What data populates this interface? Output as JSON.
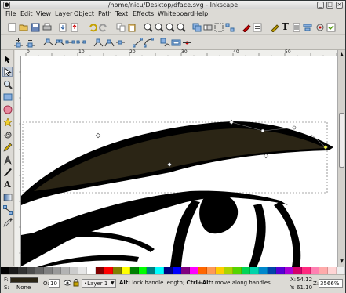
{
  "window": {
    "title": "/home/nicu/Desktop/dface.svg - Inkscape"
  },
  "menu": [
    "File",
    "Edit",
    "View",
    "Layer",
    "Object",
    "Path",
    "Text",
    "Effects",
    "Whiteboard",
    "Help"
  ],
  "commands_bar": {
    "text_tool_glyph": "T"
  },
  "tools": [
    {
      "name": "selector-tool-icon"
    },
    {
      "name": "node-tool-icon"
    },
    {
      "name": "zoom-tool-icon"
    },
    {
      "name": "rect-tool-icon"
    },
    {
      "name": "ellipse-tool-icon"
    },
    {
      "name": "star-tool-icon"
    },
    {
      "name": "spiral-tool-icon"
    },
    {
      "name": "pencil-tool-icon"
    },
    {
      "name": "pen-tool-icon"
    },
    {
      "name": "calligraphy-tool-icon"
    },
    {
      "name": "text-tool-icon",
      "glyph": "A"
    },
    {
      "name": "gradient-tool-icon"
    },
    {
      "name": "connector-tool-icon"
    },
    {
      "name": "dropper-tool-icon"
    }
  ],
  "ruler": {
    "labels": [
      "0",
      "10",
      "20",
      "30",
      "40",
      "50"
    ]
  },
  "status": {
    "fill_label": "F:",
    "stroke_label": "S:",
    "stroke_value": "None",
    "opacity_label": "O:",
    "opacity_value": "10",
    "layer_value": "•Layer 1",
    "message_bold": "Alt:",
    "message_rest": " lock handle length; ",
    "message_bold2": "Ctrl+Alt:",
    "message_rest2": " move along handles",
    "x_label": "X:",
    "x_value": "54.12",
    "y_label": "Y:",
    "y_value": "61.10",
    "zoom_label": "Z:",
    "zoom_value": "3566%"
  },
  "colors": {
    "eyebrow_fill": "#2b2515",
    "palette": [
      "#000000",
      "#1a1a1a",
      "#333333",
      "#4d4d4d",
      "#666666",
      "#808080",
      "#999999",
      "#b3b3b3",
      "#cccccc",
      "#e6e6e6",
      "#ffffff",
      "#800000",
      "#ff0000",
      "#808000",
      "#ffff00",
      "#008000",
      "#00ff00",
      "#008080",
      "#00ffff",
      "#000080",
      "#0000ff",
      "#800080",
      "#ff00ff",
      "#ff6600",
      "#ff9955",
      "#ffcc00",
      "#aad400",
      "#55d400",
      "#00d455",
      "#00d4aa",
      "#0088cc",
      "#0044aa",
      "#5500d4",
      "#aa00d4",
      "#d4006a",
      "#ff2a7f",
      "#ff80b2",
      "#ffaaaa",
      "#ffd5d5",
      "#eeeeee"
    ]
  }
}
